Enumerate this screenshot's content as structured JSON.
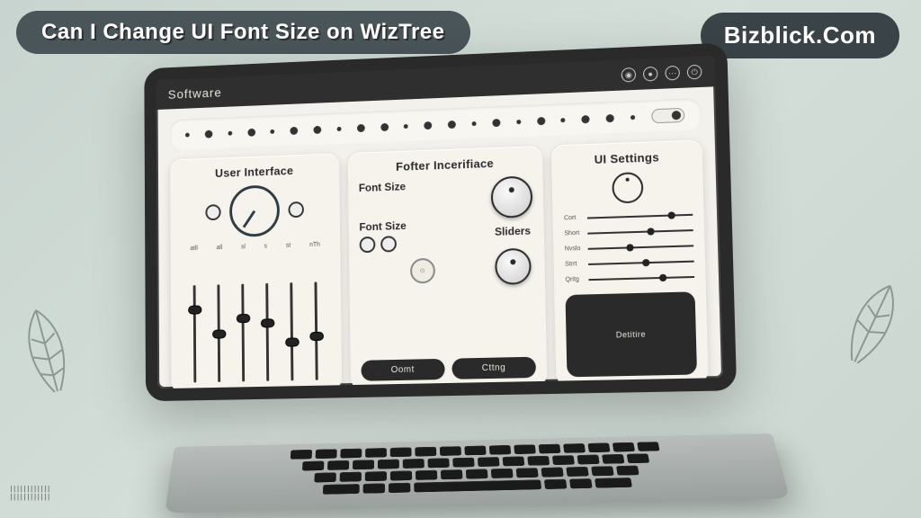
{
  "header": {
    "title": "Can I Change UI Font Size on WizTree",
    "brand": "Bizblick.Com"
  },
  "window": {
    "title": "Software"
  },
  "panels": {
    "left": {
      "title": "User Interface",
      "ticks": [
        "atll",
        "all",
        "sl",
        "s",
        "st",
        "nTh"
      ],
      "slider_positions": [
        70,
        45,
        60,
        55,
        35,
        40
      ]
    },
    "mid": {
      "title": "Fofter Incerifiace",
      "font_label": "Font Size",
      "font_label2": "Font Size",
      "sliders_label": "Sliders",
      "btn1": "Oomt",
      "btn2": "Cttng"
    },
    "right": {
      "title": "UI Settings",
      "rows": [
        {
          "label": "Cort",
          "pos": 80
        },
        {
          "label": "Short",
          "pos": 60
        },
        {
          "label": "Nvslo",
          "pos": 40
        },
        {
          "label": "Strrt",
          "pos": 55
        },
        {
          "label": "Qritg",
          "pos": 70
        }
      ],
      "btn": "Detitire"
    }
  }
}
